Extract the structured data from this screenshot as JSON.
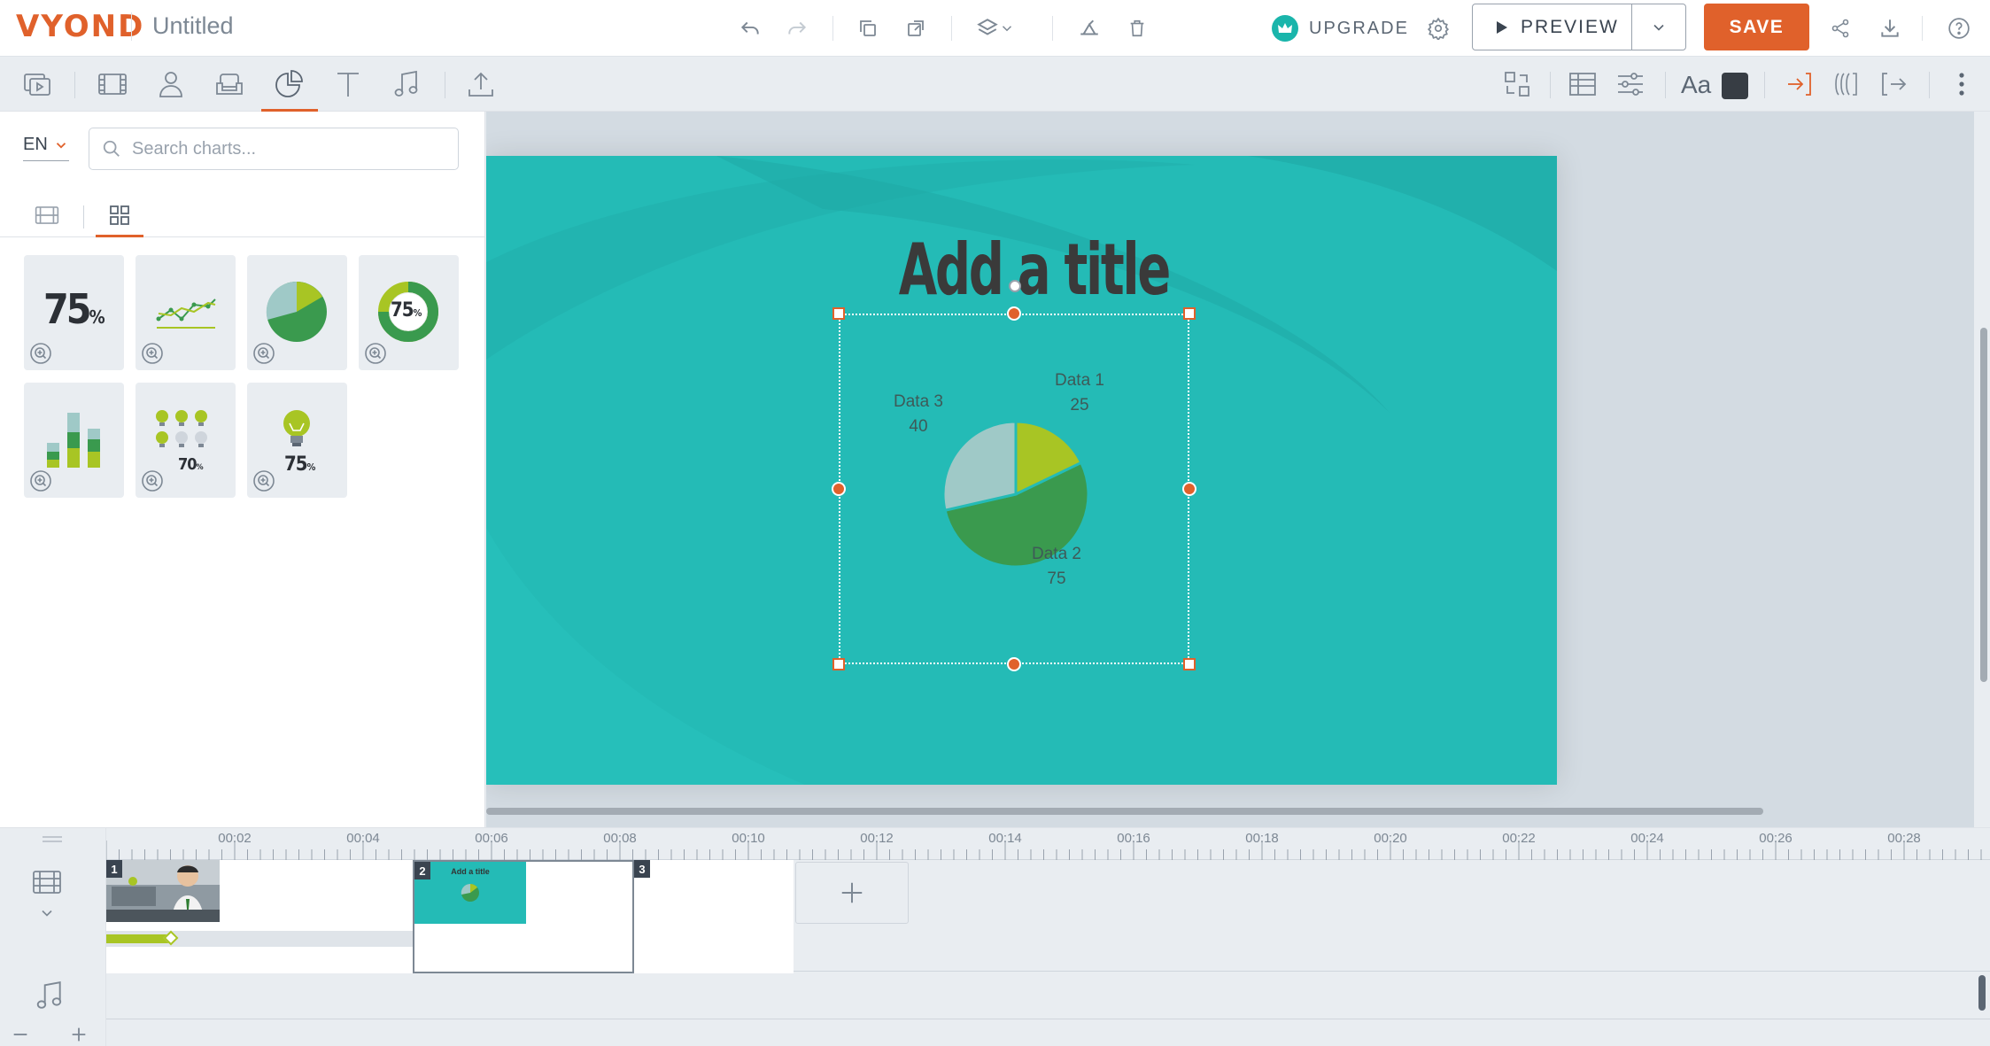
{
  "app": {
    "logo_main": "VYOND",
    "doc_title": "Untitled",
    "upgrade_label": "UPGRADE",
    "preview_label": "PREVIEW",
    "save_label": "SAVE"
  },
  "toolbar": {
    "font_label": "Aa",
    "active_tab": "charts"
  },
  "library": {
    "language": "EN",
    "search_placeholder": "Search charts...",
    "cards": [
      {
        "id": "number",
        "text": "75",
        "unit": "%"
      },
      {
        "id": "line",
        "text": ""
      },
      {
        "id": "pie",
        "text": ""
      },
      {
        "id": "donut",
        "text": "75",
        "unit": "%"
      },
      {
        "id": "bars",
        "text": ""
      },
      {
        "id": "bulbs",
        "text": "70",
        "unit": "%"
      },
      {
        "id": "bulb",
        "text": "75",
        "unit": "%"
      }
    ]
  },
  "scene": {
    "title": "Add a title",
    "background_color": "#24bbb6",
    "chart": {
      "type": "pie",
      "slices": [
        {
          "name": "Data 1",
          "value": 25,
          "color": "#a8c524"
        },
        {
          "name": "Data 2",
          "value": 75,
          "color": "#3a9a4e"
        },
        {
          "name": "Data 3",
          "value": 40,
          "color": "#9fc9c7"
        }
      ]
    }
  },
  "timeline": {
    "ticks": [
      "00:02",
      "00:04",
      "00:06",
      "00:08",
      "00:10",
      "00:12",
      "00:14",
      "00:16",
      "00:18",
      "00:20",
      "00:22",
      "00:24",
      "00:26",
      "00:28"
    ],
    "scenes": [
      {
        "number": "1",
        "thumb_title": ""
      },
      {
        "number": "2",
        "thumb_title": "Add a title"
      },
      {
        "number": "3",
        "thumb_title": ""
      }
    ]
  },
  "colors": {
    "accent": "#e0612b",
    "scene_teal": "#24bbb6",
    "upgrade_teal": "#1ab5ab"
  }
}
